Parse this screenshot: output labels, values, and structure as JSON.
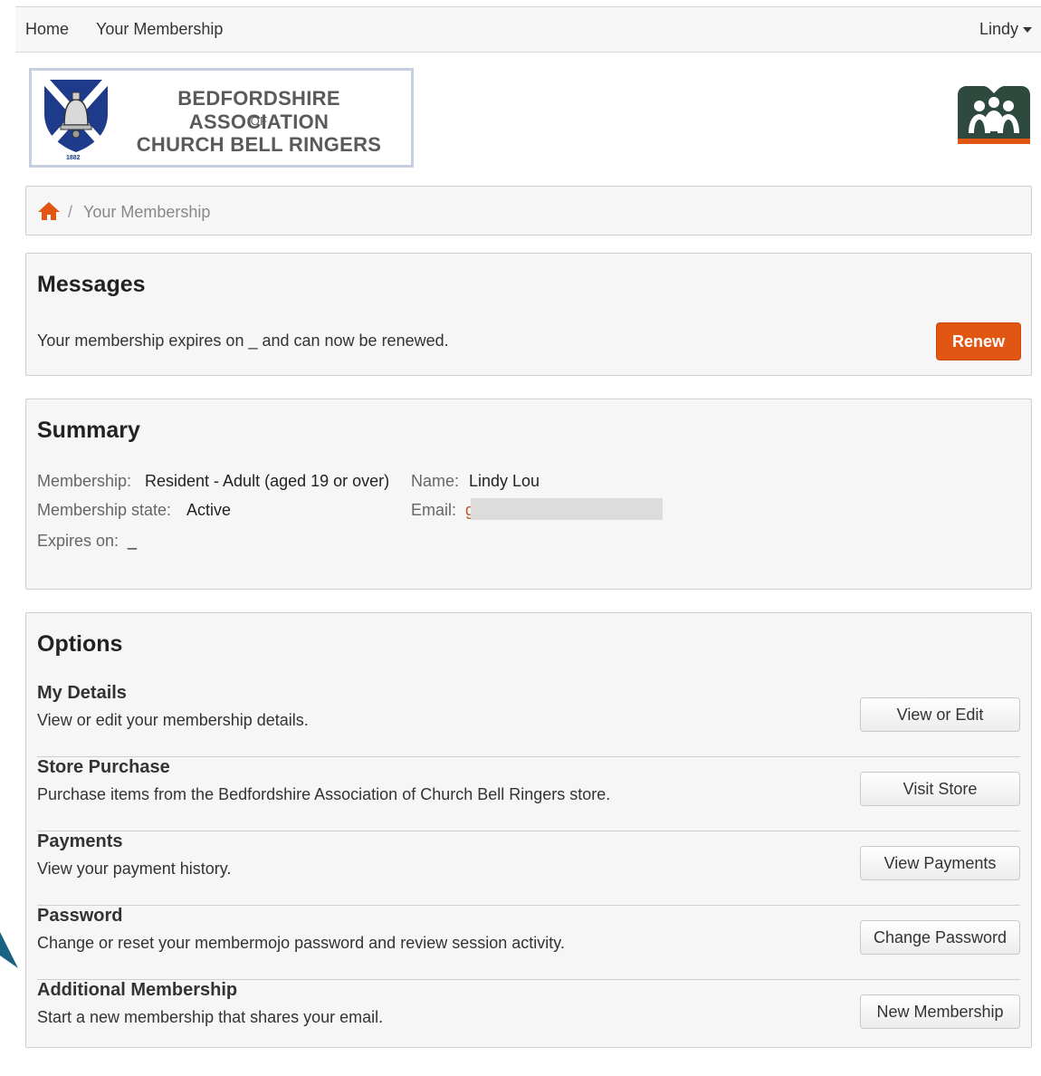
{
  "nav": {
    "home": "Home",
    "membership": "Your Membership",
    "user": "Lindy"
  },
  "logo": {
    "line1": "BEDFORDSHIRE ASSOCIATION",
    "line2": "OF",
    "line3": "CHURCH BELL RINGERS",
    "year": "1882"
  },
  "breadcrumb": {
    "separator": "/",
    "current": "Your Membership"
  },
  "messages": {
    "title": "Messages",
    "text": "Your membership expires on _ and can now be renewed.",
    "renew_label": "Renew"
  },
  "summary": {
    "title": "Summary",
    "membership_label": "Membership:",
    "membership_value": "Resident - Adult (aged 19 or over)",
    "state_label": "Membership state:",
    "state_value": "Active",
    "expires_label": "Expires on:",
    "expires_value": "_",
    "name_label": "Name:",
    "name_value": "Lindy Lou",
    "email_label": "Email:",
    "email_value": "g"
  },
  "options": {
    "title": "Options",
    "items": [
      {
        "title": "My Details",
        "desc": "View or edit your membership details.",
        "button": "View or Edit"
      },
      {
        "title": "Store Purchase",
        "desc": "Purchase items from the Bedfordshire Association of Church Bell Ringers store.",
        "button": "Visit Store"
      },
      {
        "title": "Payments",
        "desc": "View your payment history.",
        "button": "View Payments"
      },
      {
        "title": "Password",
        "desc": "Change or reset your membermojo password and review session activity.",
        "button": "Change Password"
      },
      {
        "title": "Additional Membership",
        "desc": "Start a new membership that shares your email.",
        "button": "New Membership"
      }
    ]
  },
  "colors": {
    "accent": "#e25614",
    "panel_bg": "#f6f6f6",
    "arrow": "#1a6283"
  }
}
